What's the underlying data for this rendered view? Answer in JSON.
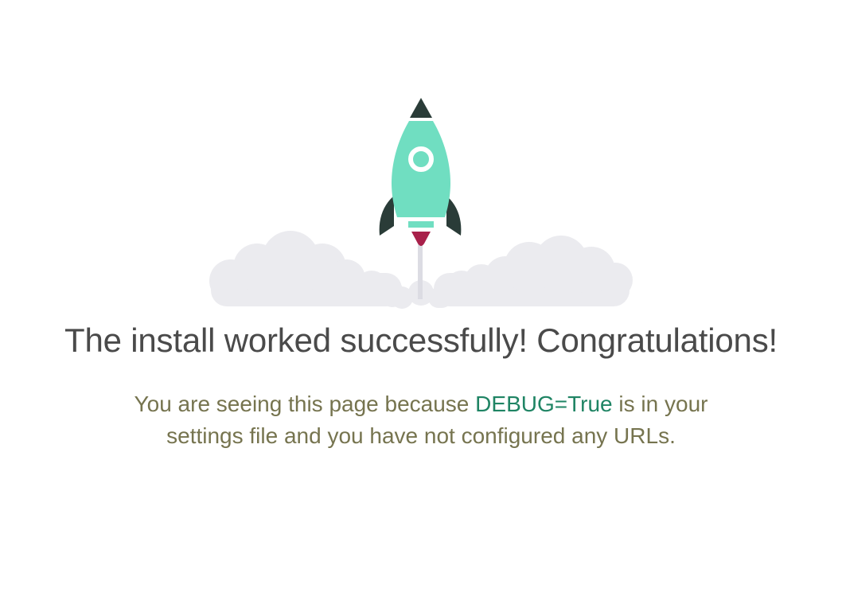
{
  "page": {
    "headline": "The install worked successfully! Congratulations!",
    "message_before": "You are seeing this page because ",
    "debug_setting": "DEBUG=True",
    "message_after": " is in your settings file and you have not configured any URLs."
  },
  "illustration": {
    "icon": "rocket-launch-icon"
  },
  "colors": {
    "rocket_body": "#70dec1",
    "rocket_dark": "#2a3c38",
    "flame": "#a8204a",
    "cloud": "#ebebef",
    "headline": "#4a4a4a",
    "body_text": "#76744f",
    "accent": "#1f8464"
  }
}
